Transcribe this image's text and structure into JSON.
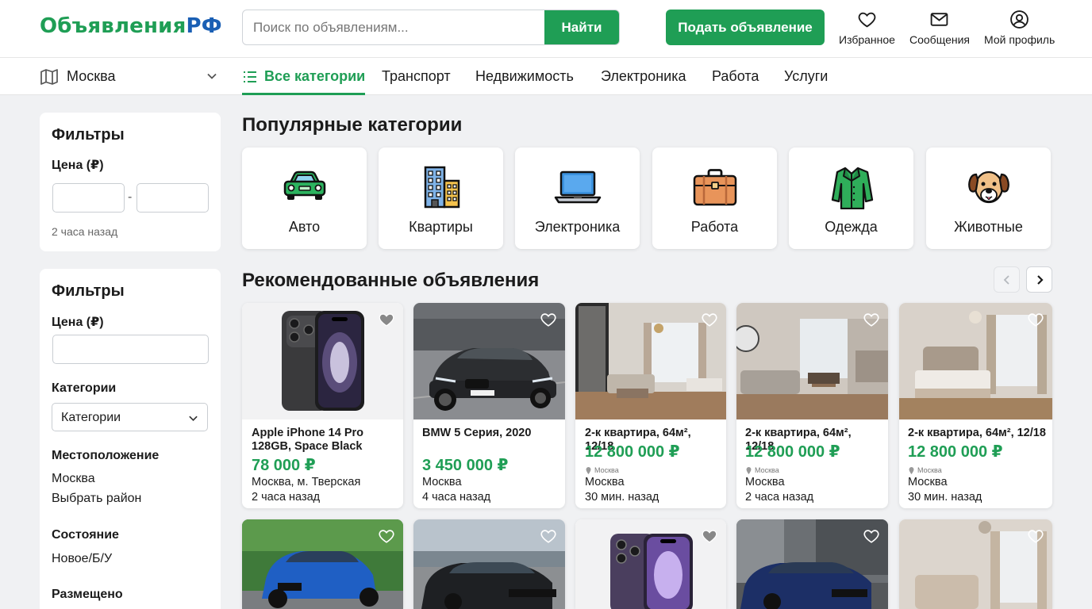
{
  "header": {
    "logo_part1": "Объявления",
    "logo_part2": "РФ",
    "search_placeholder": "Поиск по объявлениям...",
    "search_button": "Найти",
    "post_button": "Подать объявление",
    "favorites": "Избранное",
    "messages": "Сообщения",
    "profile": "Мой профиль"
  },
  "nav": {
    "city": "Москва",
    "tabs": [
      "Все категории",
      "Транспорт",
      "Недвижимость",
      "Электроника",
      "Работа",
      "Услуги"
    ]
  },
  "sidebar": {
    "panel1": {
      "title": "Фильтры",
      "price_label": "Цена (₽)",
      "separator": "-",
      "note": "2 часа назад"
    },
    "panel2": {
      "title": "Фильтры",
      "price_label": "Цена (₽)",
      "categories_label": "Категории",
      "categories_select": "Категории",
      "location_label": "Местоположение",
      "location_value": "Москва",
      "location_district": "Выбрать район",
      "condition_label": "Состояние",
      "condition_value": "Новое/Б/У",
      "posted_label": "Размещено"
    }
  },
  "popular": {
    "title": "Популярные категории",
    "items": [
      {
        "name": "Авто",
        "icon": "car-icon"
      },
      {
        "name": "Квартиры",
        "icon": "building-icon"
      },
      {
        "name": "Электроника",
        "icon": "laptop-icon"
      },
      {
        "name": "Работа",
        "icon": "briefcase-icon"
      },
      {
        "name": "Одежда",
        "icon": "jacket-icon"
      },
      {
        "name": "Животные",
        "icon": "dog-icon"
      }
    ]
  },
  "recommended": {
    "title": "Рекомендованные объявления",
    "listings": [
      {
        "title": "Apple iPhone 14 Pro 128GB, Space Black",
        "price": "78 000 ₽",
        "location": "Москва, м. Тверская",
        "time": "2 часа назад",
        "image": "iphone-black"
      },
      {
        "title": "BMW 5 Серия, 2020",
        "price": "3 450 000 ₽",
        "location": "Москва",
        "time": "4 часа назад",
        "image": "bmw-dark"
      },
      {
        "title": "2-к квартира, 64м², 12/18",
        "price": "12 800 000 ₽",
        "location_small": "Москва",
        "location": "Москва",
        "time": "30 мин. назад",
        "image": "living-room"
      },
      {
        "title": "2-к квартира, 64м², 12/18",
        "price": "12 800 000 ₽",
        "location_small": "Москва",
        "location": "Москва",
        "time": "2 часа назад",
        "image": "living-kitchen"
      },
      {
        "title": "2-к квартира, 64м², 12/18",
        "price": "12 800 000 ₽",
        "location_small": "Москва",
        "location": "Москва",
        "time": "30 мин. назад",
        "image": "bedroom"
      }
    ],
    "row2_images": [
      "blue-suv",
      "black-sedan",
      "iphone-purple",
      "blue-sedan",
      "bedroom-2"
    ]
  },
  "colors": {
    "brand_green": "#1f9e55",
    "brand_blue": "#1a5fb4",
    "background": "#f0f1f3"
  }
}
